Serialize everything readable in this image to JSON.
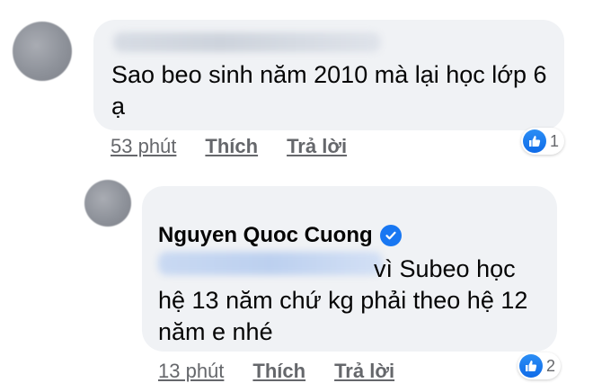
{
  "comment1": {
    "text": "Sao beo sinh năm 2010 mà lại học lớp 6 ạ",
    "time": "53 phút",
    "like_label": "Thích",
    "reply_label": "Trả lời",
    "reaction_count": "1"
  },
  "comment2": {
    "author": "Nguyen Quoc Cuong",
    "text": "vì Subeo học hệ 13 năm chứ kg phải theo hệ 12 năm e nhé",
    "time": "13 phút",
    "like_label": "Thích",
    "reply_label": "Trả lời",
    "reaction_count": "2"
  },
  "icons": {
    "verified": "verified-check-icon",
    "like": "thumbs-up-icon"
  },
  "colors": {
    "bubble": "#f0f2f5",
    "secondary_text": "#65676b",
    "accent": "#1877f2"
  }
}
